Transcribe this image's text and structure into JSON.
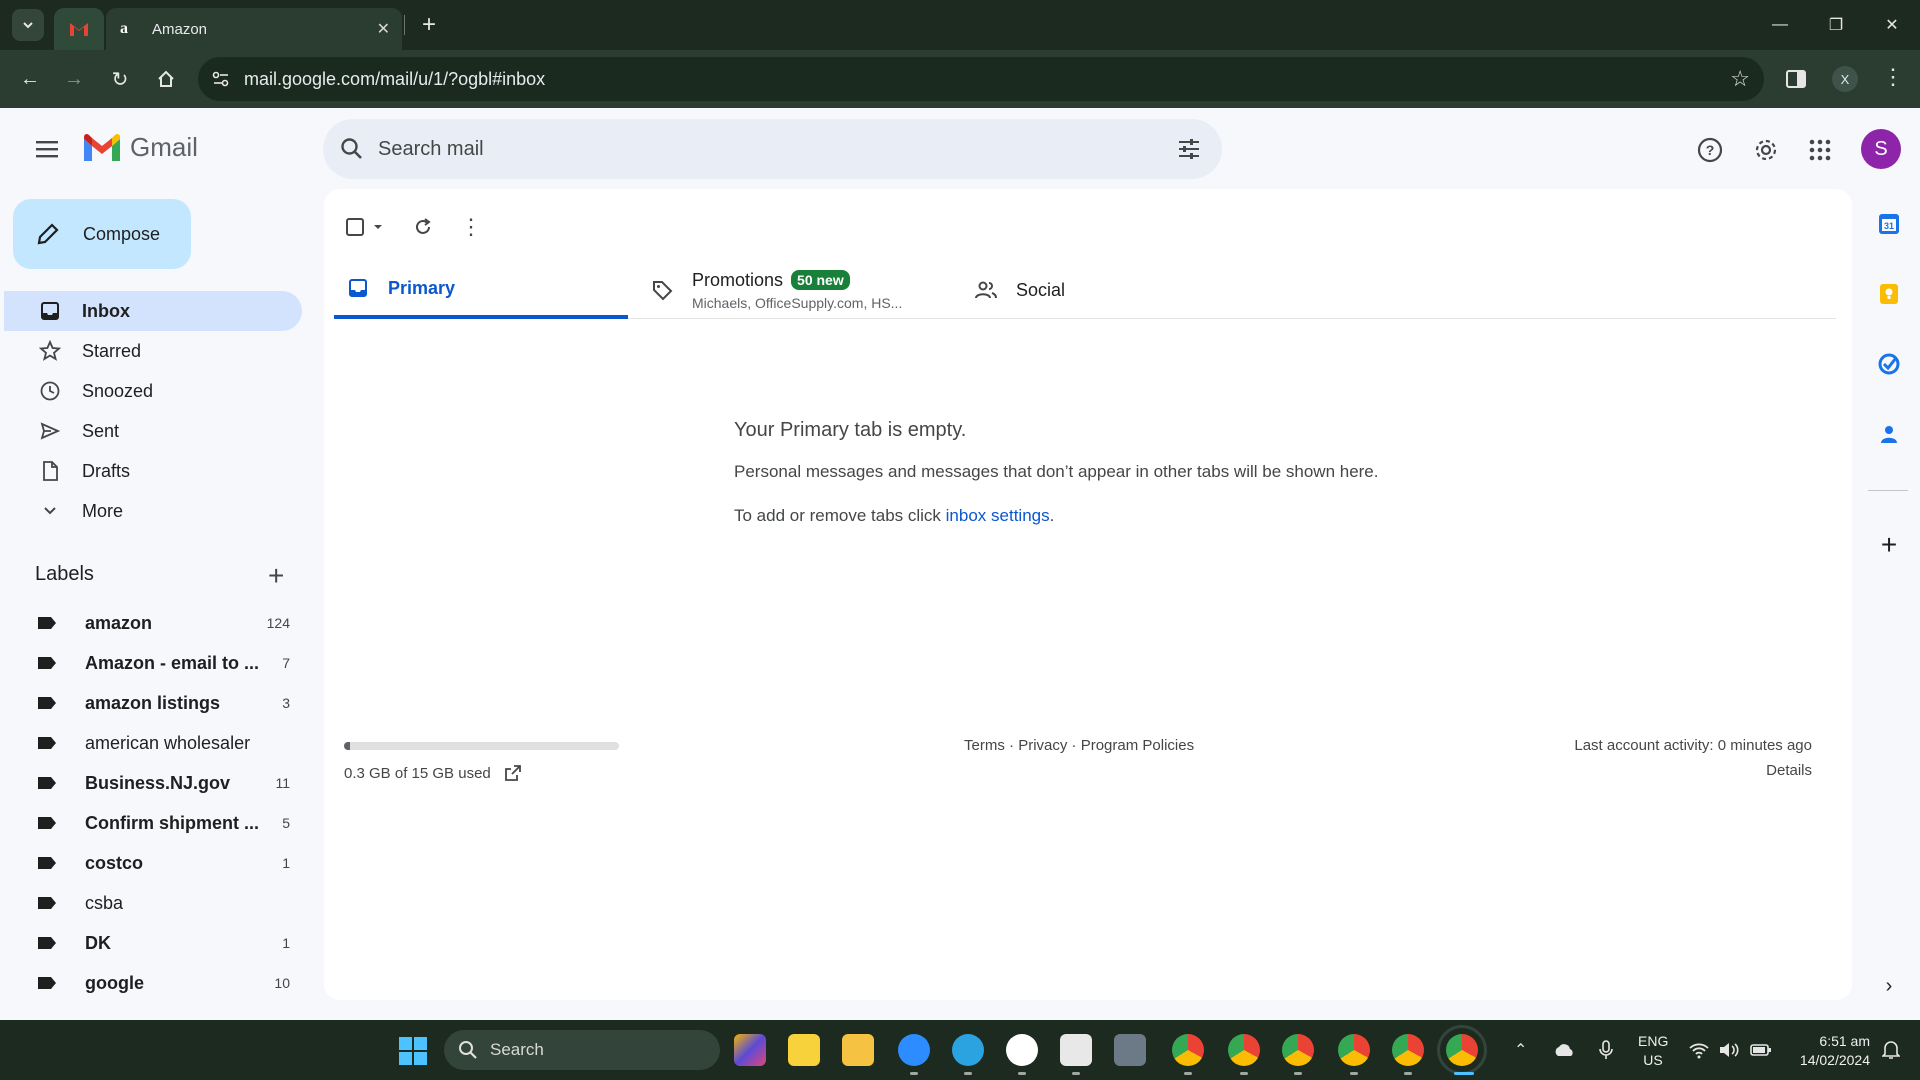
{
  "browser": {
    "tab_title": "Amazon",
    "tab_favicon_letter": "a",
    "url": "mail.google.com/mail/u/1/?ogbl#inbox",
    "profile_initial": "X"
  },
  "gmail": {
    "logo_text": "Gmail",
    "search_placeholder": "Search mail",
    "avatar_initial": "S",
    "compose_label": "Compose",
    "nav": [
      {
        "label": "Inbox",
        "icon": "inbox-icon"
      },
      {
        "label": "Starred",
        "icon": "star-icon"
      },
      {
        "label": "Snoozed",
        "icon": "clock-icon"
      },
      {
        "label": "Sent",
        "icon": "send-icon"
      },
      {
        "label": "Drafts",
        "icon": "draft-icon"
      },
      {
        "label": "More",
        "icon": "chevron-down-icon"
      }
    ],
    "labels_heading": "Labels",
    "labels": [
      {
        "name": "amazon",
        "count": "124",
        "bold": true
      },
      {
        "name": "Amazon - email to ...",
        "count": "7",
        "bold": true
      },
      {
        "name": "amazon listings",
        "count": "3",
        "bold": true
      },
      {
        "name": "american wholesaler",
        "count": "",
        "bold": false
      },
      {
        "name": "Business.NJ.gov",
        "count": "11",
        "bold": true
      },
      {
        "name": "Confirm shipment ...",
        "count": "5",
        "bold": true
      },
      {
        "name": "costco",
        "count": "1",
        "bold": true
      },
      {
        "name": "csba",
        "count": "",
        "bold": false
      },
      {
        "name": "DK",
        "count": "1",
        "bold": true
      },
      {
        "name": "google",
        "count": "10",
        "bold": true
      }
    ],
    "tabs": {
      "primary": "Primary",
      "promotions": "Promotions",
      "promotions_badge": "50 new",
      "promotions_senders": "Michaels, OfficeSupply.com, HS...",
      "social": "Social"
    },
    "empty": {
      "title": "Your Primary tab is empty.",
      "line1": "Personal messages and messages that don’t appear in other tabs will be shown here.",
      "line2_prefix": "To add or remove tabs click ",
      "line2_link": "inbox settings",
      "line2_suffix": "."
    },
    "storage": {
      "text": "0.3 GB of 15 GB used",
      "fraction": 0.02
    },
    "footer": {
      "terms": "Terms",
      "privacy": "Privacy",
      "policies": "Program Policies",
      "last_activity": "Last account activity: 0 minutes ago",
      "details": "Details"
    },
    "side_panel": {
      "calendar_day": "31"
    }
  },
  "taskbar": {
    "search_label": "Search",
    "lang_line1": "ENG",
    "lang_line2": "US",
    "time": "6:51 am",
    "date": "14/02/2024"
  },
  "colors": {
    "accent": "#0b57d0",
    "compose_bg": "#c2e7ff",
    "active_nav": "#d3e3fd",
    "badge_green": "#188038",
    "avatar": "#8e24aa"
  }
}
